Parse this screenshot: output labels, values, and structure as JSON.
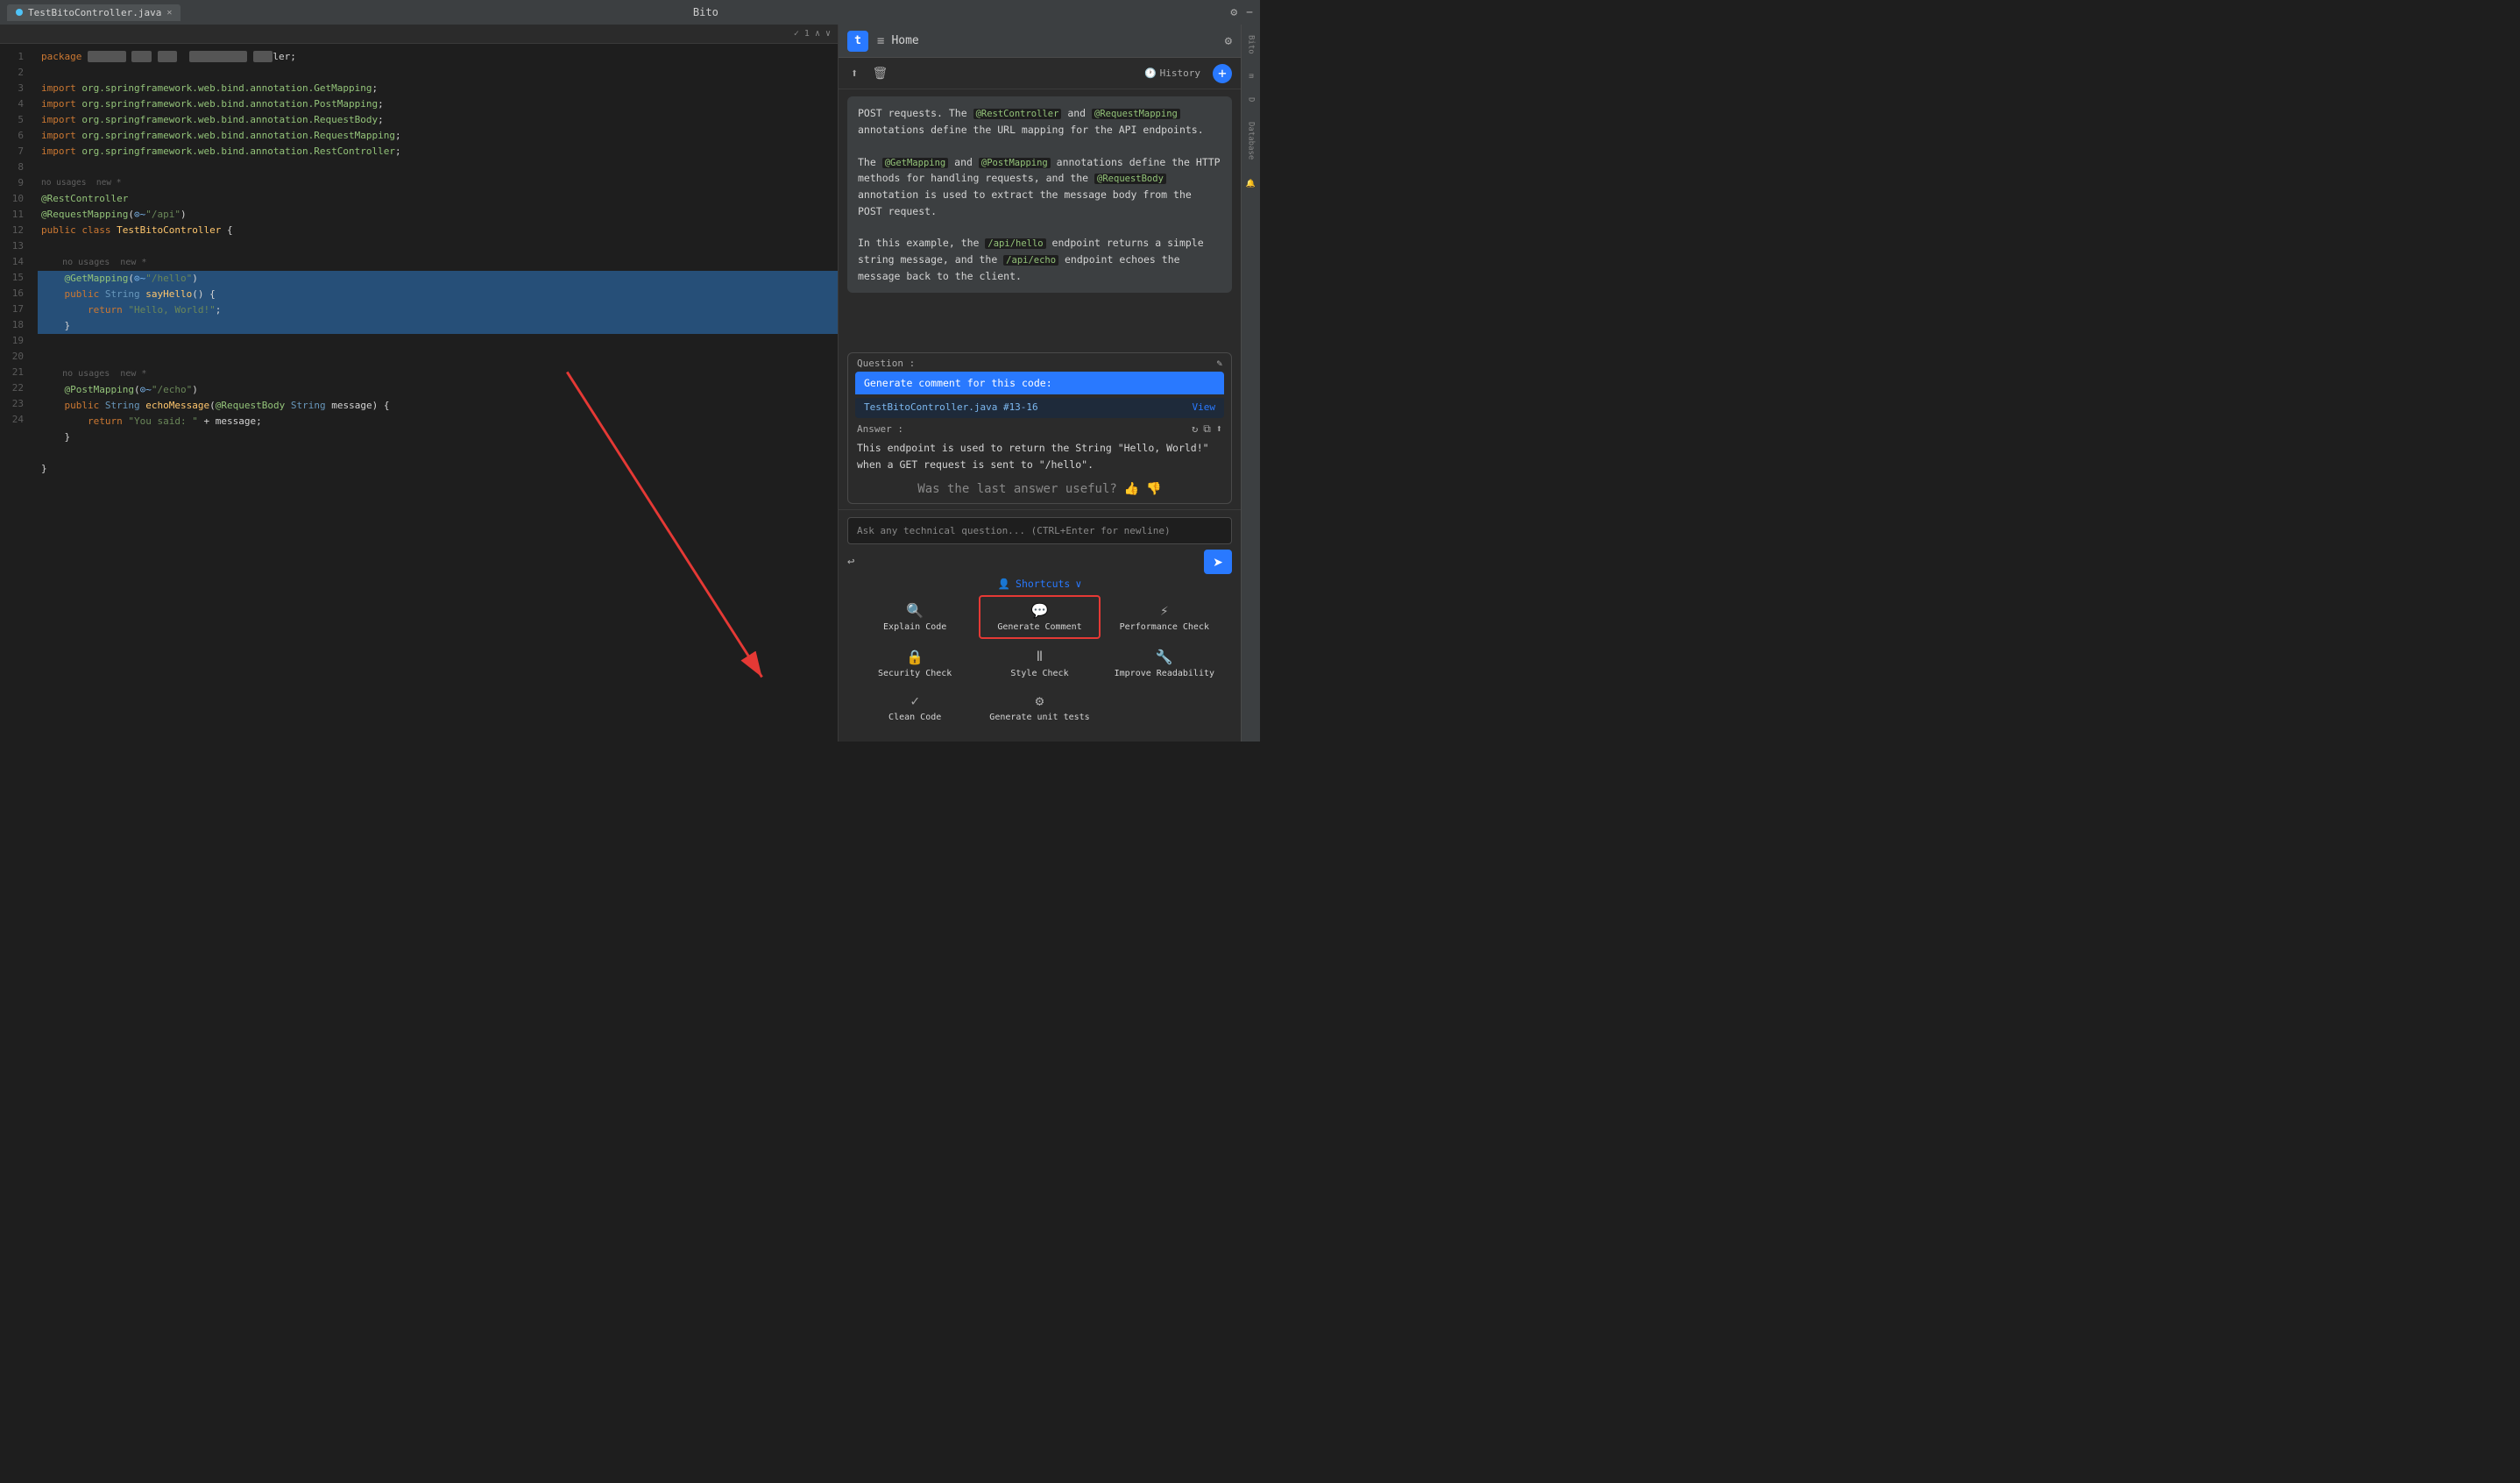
{
  "titleBar": {
    "tab": "TestBitoController.java",
    "appName": "Bito",
    "closeSymbol": "✕"
  },
  "editorToolbar": {
    "checkmark": "✓ 1",
    "arrowUp": "∧",
    "arrowDown": "∨"
  },
  "codeLines": [
    {
      "num": "1",
      "text": "package                           ler;",
      "selected": false
    },
    {
      "num": "2",
      "text": "",
      "selected": false
    },
    {
      "num": "3",
      "text": "import org.springframework.web.bind.annotation.GetMapping;",
      "selected": false
    },
    {
      "num": "4",
      "text": "import org.springframework.web.bind.annotation.PostMapping;",
      "selected": false
    },
    {
      "num": "5",
      "text": "import org.springframework.web.bind.annotation.RequestBody;",
      "selected": false
    },
    {
      "num": "6",
      "text": "import org.springframework.web.bind.annotation.RequestMapping;",
      "selected": false
    },
    {
      "num": "7",
      "text": "import org.springframework.web.bind.annotation.RestController;",
      "selected": false
    },
    {
      "num": "8",
      "text": "",
      "selected": false
    },
    {
      "num": "9",
      "text": "@RestController",
      "selected": false
    },
    {
      "num": "10",
      "text": "@RequestMapping(\"/api\")",
      "selected": false
    },
    {
      "num": "11",
      "text": "public class TestBitoController {",
      "selected": false
    },
    {
      "num": "12",
      "text": "",
      "selected": false
    },
    {
      "num": "13",
      "text": "    @GetMapping(\"/hello\")",
      "selected": true
    },
    {
      "num": "14",
      "text": "    public String sayHello() {",
      "selected": true
    },
    {
      "num": "15",
      "text": "        return \"Hello, World!\";",
      "selected": true
    },
    {
      "num": "16",
      "text": "    }",
      "selected": true
    },
    {
      "num": "17",
      "text": "",
      "selected": false
    },
    {
      "num": "18",
      "text": "",
      "selected": false
    },
    {
      "num": "19",
      "text": "    @PostMapping(\"/echo\")",
      "selected": false
    },
    {
      "num": "20",
      "text": "    public String echoMessage(@RequestBody String message) {",
      "selected": false
    },
    {
      "num": "21",
      "text": "        return \"You said: \" + message;",
      "selected": false
    },
    {
      "num": "22",
      "text": "    }",
      "selected": false
    },
    {
      "num": "23",
      "text": "",
      "selected": false
    },
    {
      "num": "24",
      "text": "}",
      "selected": false
    }
  ],
  "bitoPanel": {
    "logoText": "t",
    "homeLabel": "Home",
    "historyLabel": "History",
    "addSymbol": "+",
    "shareIcon": "⬆",
    "deleteIcon": "🗑"
  },
  "chatBubble": {
    "text1": "POST requests. The @RestController and @RequestMapping annotations define the URL mapping for the API endpoints.",
    "text2": "The @GetMapping and @PostMapping annotations define the HTTP methods for handling requests, and the @RequestBody annotation is used to extract the message body from the POST request.",
    "text3": "In this example, the /api/hello endpoint returns a simple string message, and the /api/echo endpoint echoes the message back to the client."
  },
  "questionSection": {
    "label": "Question :",
    "editIcon": "✎",
    "questionText": "Generate comment for this code:",
    "fileRef": "TestBitoController.java #13-16",
    "viewLabel": "View"
  },
  "answerSection": {
    "label": "Answer :",
    "refreshIcon": "↻",
    "copyIcon": "⧉",
    "shareIcon": "⬆",
    "answerText": "This endpoint is used to return the String \"Hello, World!\" when a GET request is sent to \"/hello\".",
    "feedbackText": "Was the last answer useful?",
    "thumbUp": "👍",
    "thumbDown": "👎"
  },
  "inputArea": {
    "placeholder": "Ask any technical question... (CTRL+Enter for newline)",
    "undoIcon": "↩",
    "sendIcon": "➤"
  },
  "shortcuts": {
    "headerIcon": "👤",
    "headerLabel": "Shortcuts",
    "chevron": "∨",
    "items": [
      {
        "icon": "🔍",
        "label": "Explain Code",
        "highlighted": false
      },
      {
        "icon": "💬",
        "label": "Generate Comment",
        "highlighted": true
      },
      {
        "icon": "⚡",
        "label": "Performance Check",
        "highlighted": false
      },
      {
        "icon": "🔒",
        "label": "Security Check",
        "highlighted": false
      },
      {
        "icon": "Ⅱ",
        "label": "Style Check",
        "highlighted": false
      },
      {
        "icon": "🔧",
        "label": "Improve Readability",
        "highlighted": false
      },
      {
        "icon": "✓",
        "label": "Clean Code",
        "highlighted": false
      },
      {
        "icon": "⚙",
        "label": "Generate unit tests",
        "highlighted": false
      }
    ]
  },
  "sideIcons": [
    "Bito",
    "m",
    "D",
    "Database",
    "Notifications"
  ],
  "arrowAnnotation": "red arrow pointing to Generate Comment button"
}
